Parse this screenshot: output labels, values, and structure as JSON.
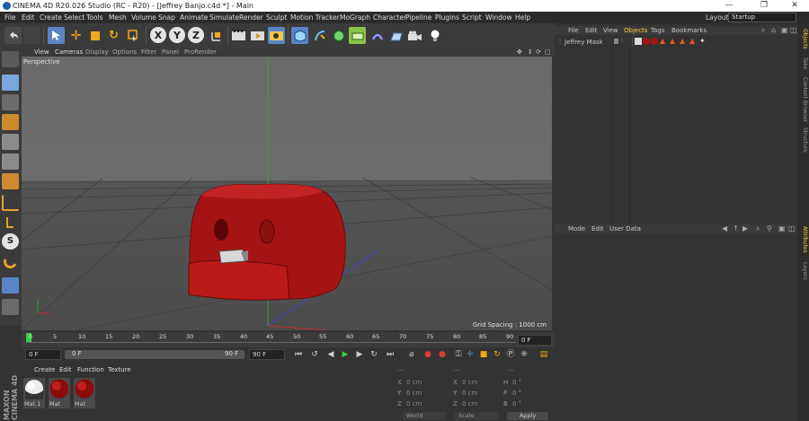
{
  "window": {
    "title": "CINEMA 4D R20.026 Studio (RC - R20) - [Jeffrey Banjo.c4d *] - Main",
    "minimize": "—",
    "restore": "❐",
    "close": "✕"
  },
  "menu": {
    "items": [
      "File",
      "Edit",
      "Create",
      "Select",
      "Tools",
      "Mesh",
      "Volume",
      "Snap",
      "Animate",
      "Simulate",
      "Render",
      "Sculpt",
      "Motion Tracker",
      "MoGraph",
      "Character",
      "Pipeline",
      "Plugins",
      "Script",
      "Window",
      "Help"
    ],
    "layout_label": "Layout:",
    "layout_value": "Startup"
  },
  "toolbar": {
    "axis_x": "X",
    "axis_y": "Y",
    "axis_z": "Z"
  },
  "viewport": {
    "menu": [
      "View",
      "Cameras",
      "Display",
      "Options",
      "Filter",
      "Panel",
      "ProRender"
    ],
    "label": "Perspective",
    "grid_spacing": "Grid Spacing : 1000 cm"
  },
  "timeline": {
    "ticks": [
      "0",
      "5",
      "10",
      "15",
      "20",
      "25",
      "30",
      "35",
      "40",
      "45",
      "50",
      "55",
      "60",
      "65",
      "70",
      "75",
      "80",
      "85",
      "90"
    ],
    "current_frame": "0 F"
  },
  "transport": {
    "start": "0 F",
    "slider_start": "0 F",
    "slider_end": "90 F",
    "end": "90 F"
  },
  "material_manager": {
    "menu": [
      "Create",
      "Edit",
      "Function",
      "Texture"
    ],
    "materials": [
      "Mat.1",
      "Mat",
      "Mat"
    ],
    "maxon_logo": "MAXON CINEMA 4D"
  },
  "coordinates": {
    "rows": [
      {
        "a": "X",
        "av": "0 cm",
        "b": "X",
        "bv": "0 cm",
        "c": "H",
        "cv": "0 °"
      },
      {
        "a": "Y",
        "av": "0 cm",
        "b": "Y",
        "bv": "0 cm",
        "c": "P",
        "cv": "0 °"
      },
      {
        "a": "Z",
        "av": "0 cm",
        "b": "Z",
        "bv": "0 cm",
        "c": "B",
        "cv": "0 °"
      }
    ],
    "mode_a": "World",
    "mode_b": "Scale",
    "apply": "Apply"
  },
  "objects": {
    "menu": [
      "File",
      "Edit",
      "View",
      "Objects",
      "Tags",
      "Bookmarks"
    ],
    "object_name": "Jeffrey Mask"
  },
  "attributes": {
    "menu": [
      "Mode",
      "Edit",
      "User Data"
    ]
  },
  "side_tabs": [
    "Objects",
    "Take",
    "Content Browser",
    "Structure",
    "Attributes",
    "Layers"
  ],
  "colors": {
    "accent_yellow": "#ffcf3b",
    "model_red": "#b01515",
    "axis_green": "#2faa2f",
    "axis_blue": "#3a4bd0"
  }
}
